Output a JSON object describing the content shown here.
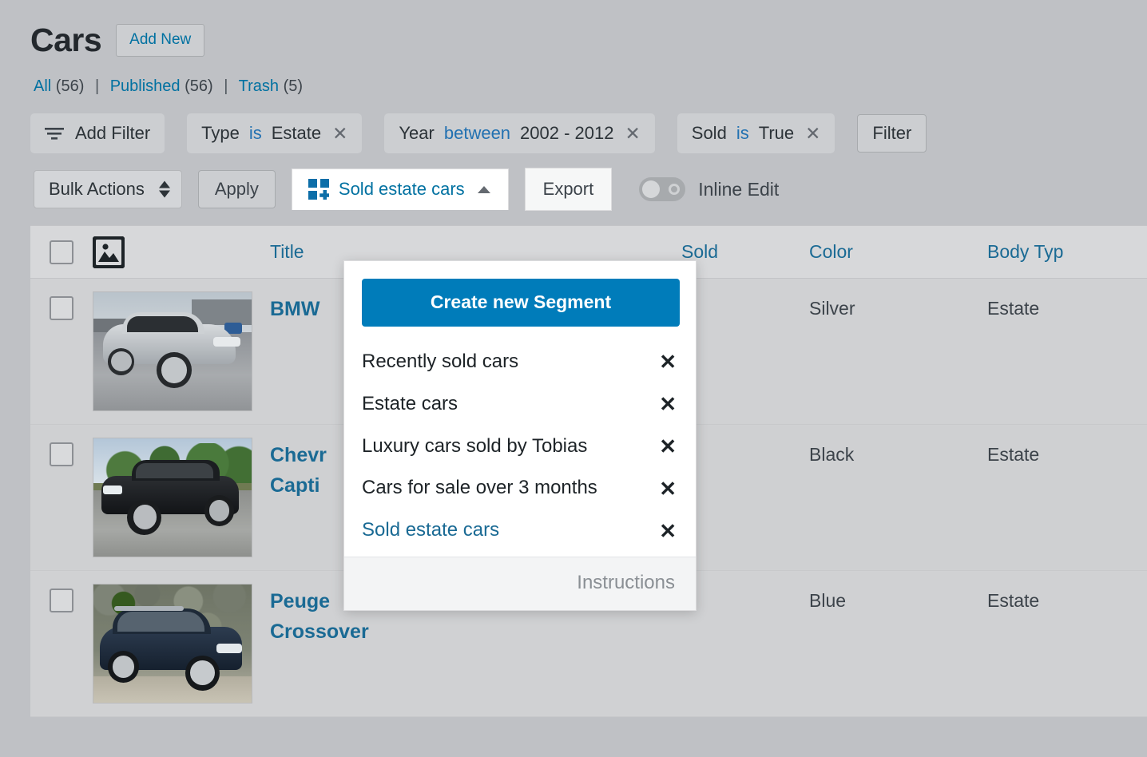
{
  "header": {
    "title": "Cars",
    "add_new_label": "Add New"
  },
  "views": [
    {
      "label": "All",
      "count": "(56)"
    },
    {
      "label": "Published",
      "count": "(56)"
    },
    {
      "label": "Trash",
      "count": "(5)"
    }
  ],
  "views_separator": "|",
  "filters": {
    "add_filter_label": "Add Filter",
    "filter_button_label": "Filter",
    "chips": [
      {
        "field": "Type",
        "operator": "is",
        "value": "Estate",
        "remove": "✕"
      },
      {
        "field": "Year",
        "operator": "between",
        "value": "2002 - 2012",
        "remove": "✕"
      },
      {
        "field": "Sold",
        "operator": "is",
        "value": "True",
        "remove": "✕"
      }
    ]
  },
  "actions": {
    "bulk_actions_label": "Bulk Actions",
    "apply_label": "Apply",
    "segment_toggle_label": "Sold estate cars",
    "export_label": "Export",
    "inline_edit_label": "Inline Edit",
    "inline_edit_state": "off"
  },
  "segment_panel": {
    "create_label": "Create new Segment",
    "items": [
      {
        "label": "Recently sold cars",
        "active": false,
        "remove": "✕"
      },
      {
        "label": "Estate cars",
        "active": false,
        "remove": "✕"
      },
      {
        "label": "Luxury cars sold by Tobias",
        "active": false,
        "remove": "✕"
      },
      {
        "label": "Cars for sale over 3 months",
        "active": false,
        "remove": "✕"
      },
      {
        "label": "Sold estate cars",
        "active": true,
        "remove": "✕"
      }
    ],
    "instructions_label": "Instructions"
  },
  "table": {
    "columns": {
      "image": "image-icon",
      "title": "Title",
      "sold": "Sold",
      "color": "Color",
      "body_type": "Body Typ"
    },
    "rows": [
      {
        "title": "BMW",
        "title_line2": "",
        "sold": "✓",
        "color": "Silver",
        "body_type": "Estate",
        "thumb": "silver-bmw-x5"
      },
      {
        "title": "Chevr",
        "title_line2": "Capti",
        "sold": "✓",
        "color": "Black",
        "body_type": "Estate",
        "thumb": "black-chevrolet-captiva"
      },
      {
        "title": "Peuge",
        "title_line2": "Crossover",
        "sold": "✓",
        "color": "Blue",
        "body_type": "Estate",
        "thumb": "blue-peugeot-crossover"
      }
    ]
  },
  "colors": {
    "page_background": "#bfc1c5",
    "accent_blue": "#007cba",
    "link_blue": "#1a6a94",
    "check_green": "#2a9d3f"
  }
}
